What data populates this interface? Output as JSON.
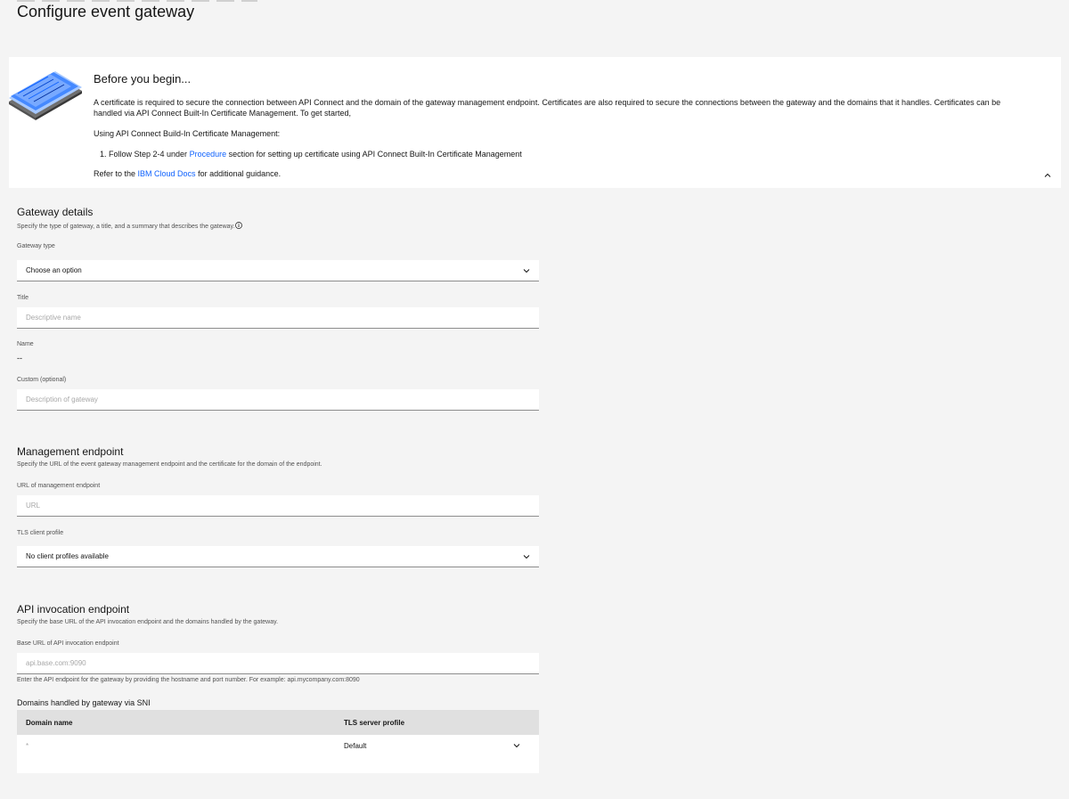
{
  "page": {
    "title": "Configure event gateway"
  },
  "notice": {
    "title": "Before you begin...",
    "body": "A certificate is required to secure the connection between API Connect and the domain of the gateway management endpoint. Certificates are also required to secure the connections between the gateway and the domains that it handles. Certificates can be handled via API Connect Built-In Certificate Management. To get started,",
    "using": "Using API Connect Build-In Certificate Management:",
    "step_prefix": "1. Follow Step 2-4 under ",
    "step_link": "Procedure",
    "step_suffix": " section for setting up certificate using API Connect Built-In Certificate Management",
    "refer_prefix": "Refer to the ",
    "refer_link": "IBM Cloud Docs",
    "refer_suffix": " for additional guidance.",
    "collapse_icon": "chevron-up-icon"
  },
  "gateway_details": {
    "title": "Gateway details",
    "description": "Specify the type of gateway, a title, and a summary that describes the gateway.",
    "type_label": "Gateway type",
    "type_value": "Choose an option",
    "title_label": "Title",
    "title_placeholder": "Descriptive name",
    "name_label": "Name",
    "name_value": "--",
    "custom_label": "Custom (optional)",
    "custom_placeholder": "Description of gateway"
  },
  "management_endpoint": {
    "title": "Management endpoint",
    "description": "Specify the URL of the event gateway management endpoint and the certificate for the domain of the endpoint.",
    "url_label": "URL of management endpoint",
    "url_placeholder": "URL",
    "tls_label": "TLS client profile",
    "tls_value": "No client profiles available"
  },
  "api_invocation": {
    "title": "API invocation endpoint",
    "description": "Specify the base URL of the API invocation endpoint and the domains handled by the gateway.",
    "base_url_label": "Base URL of API invocation endpoint",
    "base_url_placeholder": "api.base.com:9090",
    "helper": "Enter the API endpoint for the gateway by providing the hostname and port number. For example: api.mycompany.com:8090",
    "domains_title": "Domains handled by gateway via SNI",
    "columns": [
      "Domain name",
      "TLS server profile"
    ],
    "rows": [
      {
        "domain": "*",
        "profile": "Default"
      }
    ]
  },
  "colors": {
    "background": "#f4f4f4",
    "surface": "#ffffff",
    "link": "#0f62fe",
    "table_header": "#e0e0e0"
  }
}
